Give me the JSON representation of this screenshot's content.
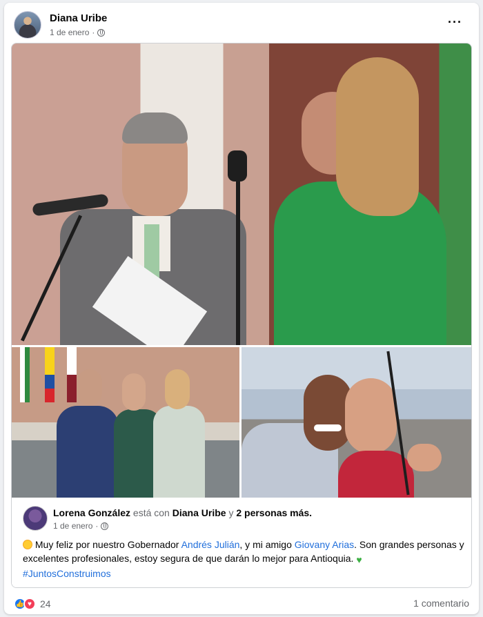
{
  "post": {
    "author": "Diana Uribe",
    "date": "1 de enero",
    "more_icon": "more-horizontal-icon",
    "privacy_icon": "globe-icon"
  },
  "shared_post": {
    "author": "Lorena González",
    "with_word": "está con",
    "tagged": "Diana Uribe",
    "and_word": "y",
    "others": "2 personas más.",
    "date": "1 de enero",
    "text_part1": "Muy feliz por nuestro Gobernador",
    "mention1": "Andrés Julián",
    "text_part2": ", y mi amigo",
    "mention2": "Giovany Arias",
    "text_part3": ". Son grandes personas y excelentes profesionales, estoy segura de que darán lo mejor para Antioquia.",
    "hashtag": "#JuntosConstruimos"
  },
  "footer": {
    "reaction_count": "24",
    "comments": "1 comentario"
  },
  "colors": {
    "link": "#216fdb",
    "like": "#1877f2",
    "love": "#f33e58"
  }
}
